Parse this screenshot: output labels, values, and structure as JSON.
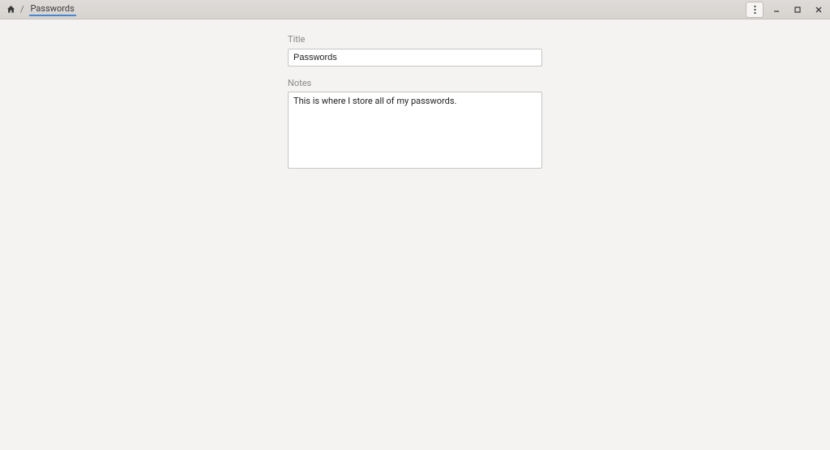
{
  "breadcrumb": {
    "current": "Passwords",
    "separator": "/"
  },
  "form": {
    "title_label": "Title",
    "title_value": "Passwords",
    "notes_label": "Notes",
    "notes_value": "This is where I store all of my passwords."
  }
}
